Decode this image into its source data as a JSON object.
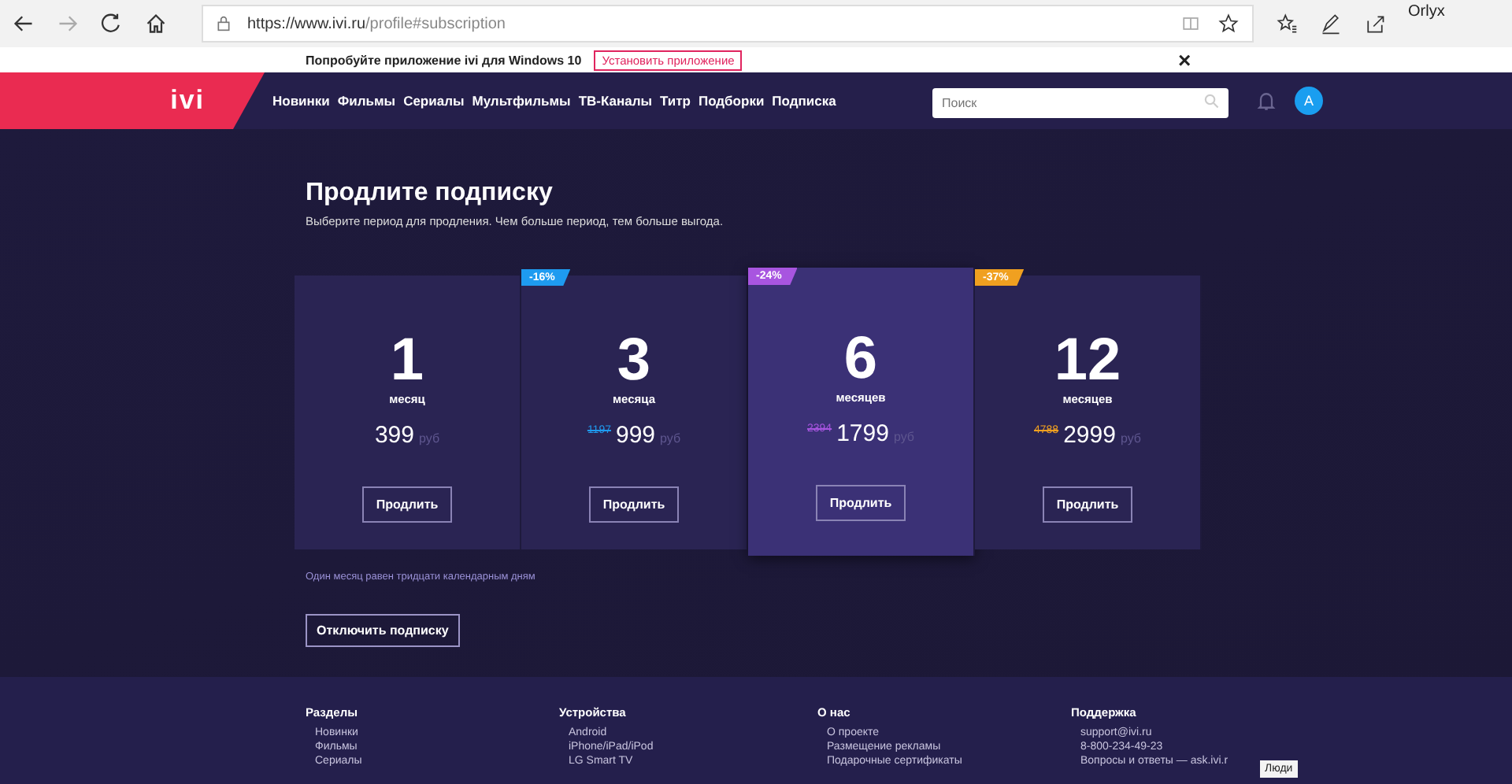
{
  "browser": {
    "url_host": "https://www.ivi.ru",
    "url_path": "/profile#subscription",
    "profile": "Orlyx"
  },
  "app_banner": {
    "text": "Попробуйте приложение ivi для Windows 10",
    "button": "Установить приложение",
    "close": "×"
  },
  "nav": {
    "logo": "ivi",
    "items": [
      "Новинки",
      "Фильмы",
      "Сериалы",
      "Мультфильмы",
      "ТВ-Каналы",
      "Титр",
      "Подборки",
      "Подписка"
    ],
    "search": {
      "placeholder": "Поиск"
    },
    "avatar": "A"
  },
  "title": "Продлите подписку",
  "subtitle": "Выберите период для продления. Чем больше период, тем больше выгода.",
  "plans": [
    {
      "count": "1",
      "unit": "месяц",
      "price": "399",
      "currency": "руб",
      "button": "Продлить",
      "selected": false
    },
    {
      "count": "3",
      "unit": "месяца",
      "old_price": "1197",
      "price": "999",
      "currency": "руб",
      "discount": "-16%",
      "color": "#1e9bf0",
      "button": "Продлить",
      "selected": false
    },
    {
      "count": "6",
      "unit": "месяцев",
      "old_price": "2394",
      "price": "1799",
      "currency": "руб",
      "discount": "-24%",
      "color": "#a855e0",
      "button": "Продлить",
      "selected": true
    },
    {
      "count": "12",
      "unit": "месяцев",
      "old_price": "4788",
      "price": "2999",
      "currency": "руб",
      "discount": "-37%",
      "color": "#f0a020",
      "button": "Продлить",
      "selected": false
    }
  ],
  "note": "Один месяц равен тридцати календарным дням",
  "cancel_button": "Отключить подписку",
  "footer": [
    {
      "heading": "Разделы",
      "links": [
        "Новинки",
        "Фильмы",
        "Сериалы"
      ]
    },
    {
      "heading": "Устройства",
      "links": [
        "Android",
        "iPhone/iPad/iPod",
        "LG Smart TV"
      ]
    },
    {
      "heading": "О нас",
      "links": [
        "О проекте",
        "Размещение рекламы",
        "Подарочные сертификаты"
      ]
    },
    {
      "heading": "Поддержка",
      "links": [
        "support@ivi.ru",
        "8-800-234-49-23",
        "Вопросы и ответы — ask.ivi.r"
      ]
    }
  ],
  "tooltip": "Люди"
}
